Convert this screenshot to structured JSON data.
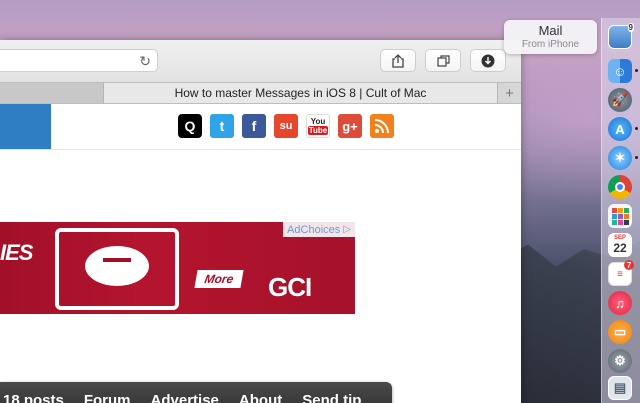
{
  "notification": {
    "title": "Mail",
    "subtitle": "From iPhone",
    "badge": "9"
  },
  "browser": {
    "tab_title": "How to master Messages in iOS 8 | Cult of Mac",
    "tab_add_label": "+",
    "toolbar": {
      "reload_icon": "reload-icon",
      "share_icon": "share-icon",
      "tabs_icon": "tabs-overview-icon",
      "download_icon": "download-icon"
    }
  },
  "page": {
    "social_icons": [
      {
        "name": "quora-icon",
        "glyph": "Q",
        "color": "#000000"
      },
      {
        "name": "twitter-icon",
        "glyph": "t",
        "color": "#2fa4e7"
      },
      {
        "name": "facebook-icon",
        "glyph": "f",
        "color": "#3b5998"
      },
      {
        "name": "stumbleupon-icon",
        "glyph": "su",
        "color": "#e4472b"
      },
      {
        "name": "youtube-icon",
        "glyph": "You Tube",
        "color": "#d61e1e"
      },
      {
        "name": "google-plus-icon",
        "glyph": "g+",
        "color": "#dd4b39"
      },
      {
        "name": "rss-icon",
        "glyph": "◉",
        "color": "#f2811d"
      }
    ],
    "ad": {
      "left_text": "IES",
      "more_label": "More",
      "logo_text": "GCI",
      "adchoices_label": "AdChoices"
    },
    "nav": [
      "18 posts",
      "Forum",
      "Advertise",
      "About",
      "Send tip"
    ]
  },
  "dock": {
    "badges": {
      "calendar_day": "22",
      "calendar_month": "SEP",
      "reminders_badge": "7"
    }
  }
}
